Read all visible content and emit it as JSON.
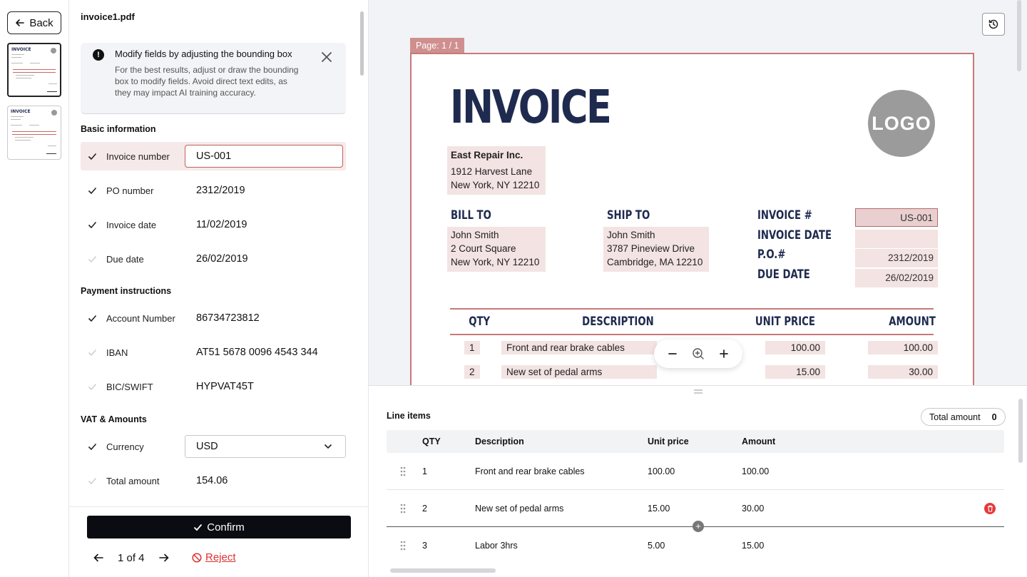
{
  "nav": {
    "back_label": "Back"
  },
  "thumbnails": [
    {
      "title": "INVOICE",
      "active": true
    },
    {
      "title": "INVOICE",
      "active": false
    }
  ],
  "form": {
    "file_name": "invoice1.pdf",
    "notice": {
      "title": "Modify fields by adjusting the bounding box",
      "body": "For the best results, adjust or draw the bounding box to modify fields. Avoid direct text edits, as they may impact AI training accuracy."
    },
    "sections": {
      "basic": "Basic information",
      "payment": "Payment instructions",
      "vat": "VAT & Amounts"
    },
    "fields": {
      "invoice_number": {
        "label": "Invoice number",
        "value": "US-001",
        "confirmed": true
      },
      "po_number": {
        "label": "PO number",
        "value": "2312/2019",
        "confirmed": true
      },
      "invoice_date": {
        "label": "Invoice date",
        "value": "11/02/2019",
        "confirmed": true
      },
      "due_date": {
        "label": "Due date",
        "value": "26/02/2019",
        "confirmed": false
      },
      "account_number": {
        "label": "Account Number",
        "value": "86734723812",
        "confirmed": true
      },
      "iban": {
        "label": "IBAN",
        "value": "AT51 5678 0096 4543 344",
        "confirmed": false
      },
      "bic": {
        "label": "BIC/SWIFT",
        "value": "HYPVAT45T",
        "confirmed": false
      },
      "currency": {
        "label": "Currency",
        "value": "USD",
        "confirmed": true
      },
      "total_amount": {
        "label": "Total amount",
        "value": "154.06",
        "confirmed": false
      }
    },
    "footer": {
      "confirm_label": "Confirm",
      "pager_text": "1 of 4",
      "reject_label": "Reject"
    }
  },
  "viewer": {
    "page_label": "Page: 1 / 1",
    "document": {
      "title": "INVOICE",
      "logo_text": "LOGO",
      "seller": {
        "name": "East Repair Inc.",
        "address1": "1912 Harvest Lane",
        "address2": "New York, NY 12210"
      },
      "bill_to": {
        "heading": "BILL TO",
        "name": "John Smith",
        "address1": "2 Court Square",
        "address2": "New York, NY 12210"
      },
      "ship_to": {
        "heading": "SHIP TO",
        "name": "John Smith",
        "address1": "3787 Pineview Drive",
        "address2": "Cambridge, MA 12210"
      },
      "meta": {
        "invoice_no_label": "INVOICE #",
        "invoice_no": "US-001",
        "invoice_date_label": "INVOICE DATE",
        "invoice_date": "",
        "po_label": "P.O.#",
        "po": "2312/2019",
        "due_label": "DUE DATE",
        "due": "26/02/2019"
      },
      "table_headers": {
        "qty": "QTY",
        "description": "DESCRIPTION",
        "unit_price": "UNIT PRICE",
        "amount": "AMOUNT"
      },
      "rows": [
        {
          "qty": "1",
          "description": "Front and rear brake cables",
          "unit_price": "100.00",
          "amount": "100.00"
        },
        {
          "qty": "2",
          "description": "New set of pedal arms",
          "unit_price": "15.00",
          "amount": "30.00"
        }
      ]
    }
  },
  "line_items": {
    "title": "Line items",
    "total_label": "Total amount",
    "total_value": "0",
    "headers": {
      "qty": "QTY",
      "description": "Description",
      "unit_price": "Unit price",
      "amount": "Amount"
    },
    "rows": [
      {
        "qty": "1",
        "description": "Front and rear brake cables",
        "unit_price": "100.00",
        "amount": "100.00"
      },
      {
        "qty": "2",
        "description": "New set of pedal arms",
        "unit_price": "15.00",
        "amount": "30.00"
      },
      {
        "qty": "3",
        "description": "Labor 3hrs",
        "unit_price": "5.00",
        "amount": "15.00"
      }
    ]
  },
  "colors": {
    "accent_red": "#c87878",
    "invoice_navy": "#1f2a4f",
    "highlight": "#f3e3e3",
    "danger": "#e53a3a"
  }
}
